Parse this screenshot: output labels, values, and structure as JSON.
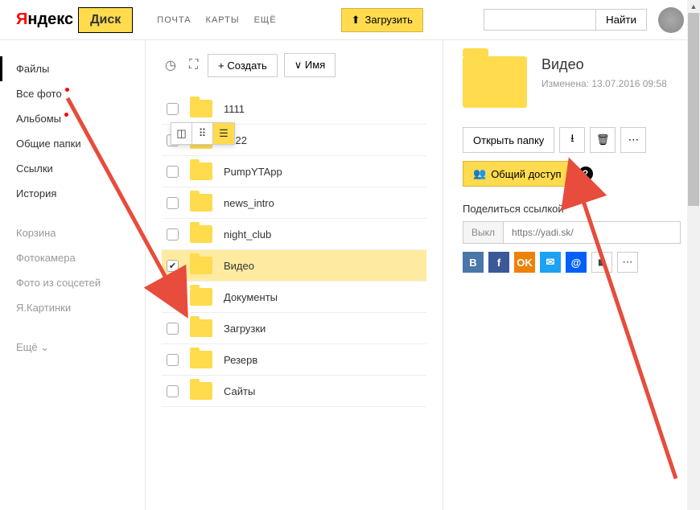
{
  "header": {
    "logo_yandex_prefix": "Я",
    "logo_yandex_rest": "ндекс",
    "logo_disk": "Диск",
    "nav": [
      "ПОЧТА",
      "КАРТЫ",
      "ЕЩЁ"
    ],
    "upload_label": "Загрузить",
    "search_btn": "Найти"
  },
  "sidebar": {
    "items_primary": [
      {
        "label": "Файлы",
        "active": true,
        "dot": false
      },
      {
        "label": "Все фото",
        "active": false,
        "dot": true
      },
      {
        "label": "Альбомы",
        "active": false,
        "dot": true
      },
      {
        "label": "Общие папки",
        "active": false,
        "dot": false
      },
      {
        "label": "Ссылки",
        "active": false,
        "dot": false
      },
      {
        "label": "История",
        "active": false,
        "dot": false
      }
    ],
    "items_secondary": [
      {
        "label": "Корзина"
      },
      {
        "label": "Фотокамера"
      },
      {
        "label": "Фото из соцсетей"
      },
      {
        "label": "Я.Картинки"
      }
    ],
    "more_label": "Ещё"
  },
  "toolbar": {
    "create_label": "+  Создать",
    "sort_label": "∨  Имя"
  },
  "files": [
    {
      "name": "1111",
      "selected": false
    },
    {
      "name": "2222",
      "selected": false
    },
    {
      "name": "PumpYTApp",
      "selected": false
    },
    {
      "name": "news_intro",
      "selected": false
    },
    {
      "name": "night_club",
      "selected": false
    },
    {
      "name": "Видео",
      "selected": true
    },
    {
      "name": "Документы",
      "selected": false
    },
    {
      "name": "Загрузки",
      "selected": false
    },
    {
      "name": "Резерв",
      "selected": false
    },
    {
      "name": "Сайты",
      "selected": false
    }
  ],
  "details": {
    "title": "Видео",
    "meta": "Изменена: 13.07.2016 09:58",
    "open_label": "Открыть папку",
    "share_label": "Общий доступ",
    "share_section": "Поделиться ссылкой",
    "toggle_label": "Выкл",
    "link_placeholder": "https://yadi.sk/"
  }
}
